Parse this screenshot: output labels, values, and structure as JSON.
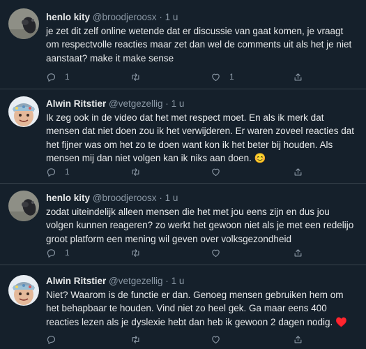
{
  "tweets": [
    {
      "name": "henlo kity",
      "handle": "@broodjeroosx",
      "separator": "·",
      "time": "1 u",
      "text": "je zet dit zelf online wetende dat er discussie van gaat komen, je vraagt om respectvolle reacties maar zet dan wel de comments uit als het je niet aanstaat? make it make sense",
      "reply_count": "1",
      "retweet_count": "",
      "like_count": "1"
    },
    {
      "name": "Alwin Ritstier",
      "handle": "@vetgezellig",
      "separator": "·",
      "time": "1 u",
      "text": "Ik zeg ook in de video dat het met respect moet. En als ik merk dat mensen dat niet doen zou ik het verwijderen. Er waren zoveel reacties dat het fijner was om het zo te doen want kon ik het beter bij houden. Als mensen mij dan niet volgen kan ik niks aan doen. 😊",
      "reply_count": "1",
      "retweet_count": "",
      "like_count": ""
    },
    {
      "name": "henlo kity",
      "handle": "@broodjeroosx",
      "separator": "·",
      "time": "1 u",
      "text": "zodat uiteindelijk alleen mensen die het met jou eens zijn en dus jou volgen kunnen reageren? zo werkt het gewoon niet als je met een redelijo groot platform een mening wil geven over volksgezondheid",
      "reply_count": "1",
      "retweet_count": "",
      "like_count": ""
    },
    {
      "name": "Alwin Ritstier",
      "handle": "@vetgezellig",
      "separator": "·",
      "time": "1 u",
      "text": "Niet? Waarom is de functie er dan. Genoeg mensen gebruiken hem om het behapbaar te houden. Vind niet zo heel gek. Ga maar eens 400 reacties lezen als je dyslexie hebt dan heb ik gewoon 2 dagen nodig. ♥️",
      "reply_count": "",
      "retweet_count": "",
      "like_count": ""
    }
  ],
  "icons": {
    "reply": "reply-icon",
    "retweet": "retweet-icon",
    "like": "heart-icon",
    "share": "share-icon"
  },
  "colors": {
    "background": "#15202b",
    "text": "#e7e9ea",
    "muted": "#8b98a5",
    "divider": "#38444d"
  }
}
